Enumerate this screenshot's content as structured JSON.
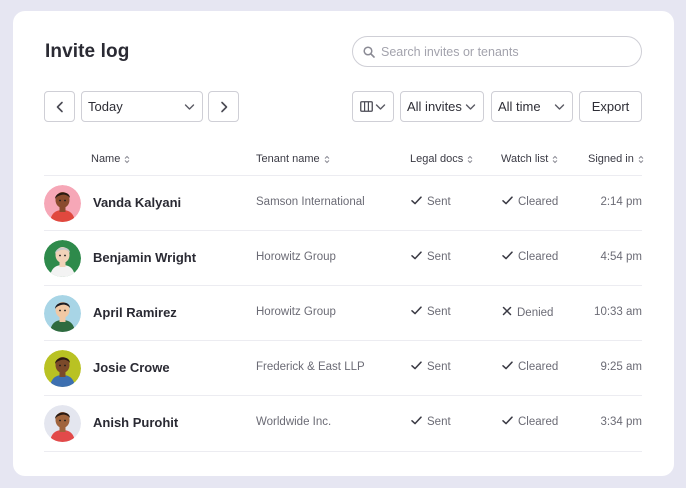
{
  "header": {
    "title": "Invite log",
    "search_placeholder": "Search invites or tenants"
  },
  "toolbar": {
    "date_select": "Today",
    "type_select": "All invites",
    "time_select": "All time",
    "export_label": "Export",
    "icons": {
      "prev": "chevron-left-icon",
      "next": "chevron-right-icon",
      "columns": "columns-icon"
    }
  },
  "table": {
    "columns": [
      "Name",
      "Tenant name",
      "Legal docs",
      "Watch list",
      "Signed in"
    ],
    "rows": [
      {
        "name": "Vanda Kalyani",
        "tenant": "Samson International",
        "legal": "Sent",
        "watch": "Cleared",
        "watch_icon": "check-icon",
        "signed": "2:14 pm",
        "avatar_bg": "#f6a7b7",
        "skin": "#8a4b2e",
        "hair": "#2a1a12",
        "shirt": "#e0483e"
      },
      {
        "name": "Benjamin Wright",
        "tenant": "Horowitz Group",
        "legal": "Sent",
        "watch": "Cleared",
        "watch_icon": "check-icon",
        "signed": "4:54 pm",
        "avatar_bg": "#2e8a4b",
        "skin": "#f1d2b8",
        "hair": "#c9c9c9",
        "shirt": "#f3f3f3"
      },
      {
        "name": "April Ramirez",
        "tenant": "Horowitz Group",
        "legal": "Sent",
        "watch": "Denied",
        "watch_icon": "x-icon",
        "signed": "10:33 am",
        "avatar_bg": "#a8d5e6",
        "skin": "#f0c8a4",
        "hair": "#1c1c22",
        "shirt": "#2f6b3f"
      },
      {
        "name": "Josie Crowe",
        "tenant": "Frederick & East LLP",
        "legal": "Sent",
        "watch": "Cleared",
        "watch_icon": "check-icon",
        "signed": "9:25 am",
        "avatar_bg": "#b9c223",
        "skin": "#7b4a2a",
        "hair": "#2a1a12",
        "shirt": "#3d6fb0"
      },
      {
        "name": "Anish Purohit",
        "tenant": "Worldwide Inc.",
        "legal": "Sent",
        "watch": "Cleared",
        "watch_icon": "check-icon",
        "signed": "3:34 pm",
        "avatar_bg": "#e4e6ef",
        "skin": "#a0643d",
        "hair": "#2a1a12",
        "shirt": "#e24a4a"
      }
    ]
  },
  "colors": {
    "background": "#e6e6f2",
    "card": "#ffffff",
    "border": "#cfcfd6",
    "text": "#2a2a33",
    "muted": "#6b6b75"
  }
}
